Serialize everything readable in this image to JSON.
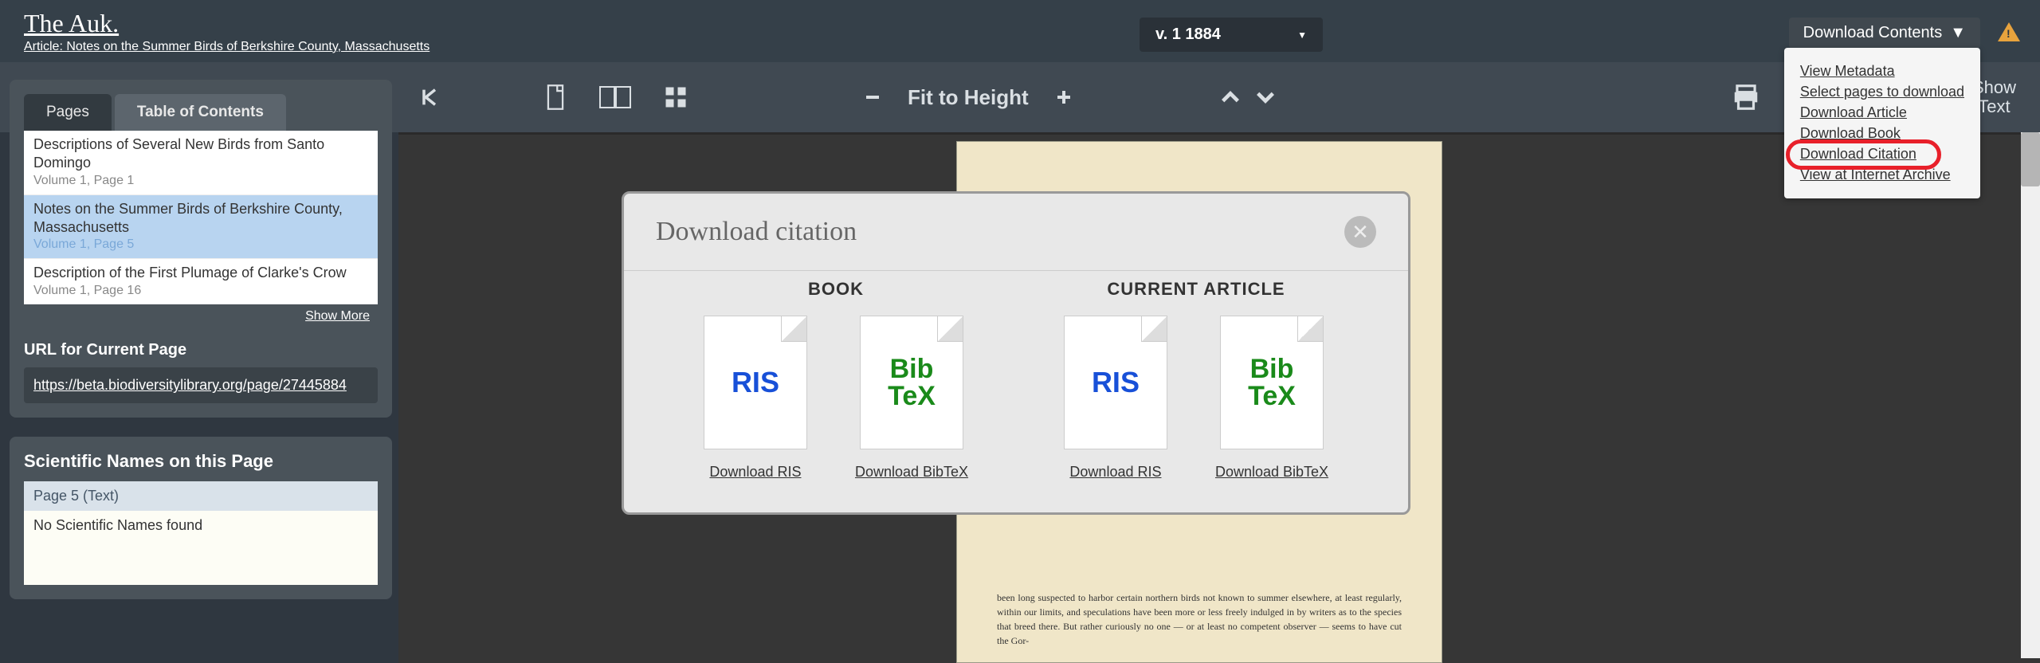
{
  "header": {
    "title": "The Auk.",
    "subtitle": "Article: Notes on the Summer Birds of Berkshire County, Massachusetts",
    "volume": "v. 1 1884",
    "download_contents": "Download Contents"
  },
  "dropdown": {
    "items": [
      "View Metadata",
      "Select pages to download",
      "Download Article",
      "Download Book",
      "Download Citation",
      "View at Internet Archive"
    ]
  },
  "toolbar": {
    "fit": "Fit to Height",
    "show_text": "Show Text"
  },
  "sidebar": {
    "tabs": {
      "pages": "Pages",
      "toc": "Table of Contents"
    },
    "toc": [
      {
        "title": "Descriptions of Several New Birds from Santo Domingo",
        "vol": "Volume 1, Page 1",
        "selected": false
      },
      {
        "title": "Notes on the Summer Birds of Berkshire County, Massachusetts",
        "vol": "Volume 1, Page 5",
        "selected": true
      },
      {
        "title": "Description of the First Plumage of Clarke's Crow",
        "vol": "Volume 1, Page 16",
        "selected": false
      }
    ],
    "show_more": "Show More",
    "url_label": "URL for Current Page",
    "url": "https://beta.biodiversitylibrary.org/page/27445884",
    "sci_label": "Scientific Names on this Page",
    "sci_page": "Page 5 (Text)",
    "sci_none": "No Scientific Names found"
  },
  "modal": {
    "title": "Download citation",
    "book": "BOOK",
    "article": "CURRENT ARTICLE",
    "ris": "RIS",
    "bibtex_l1": "Bib",
    "bibtex_l2": "TeX",
    "download_ris": "Download RIS",
    "download_bibtex": "Download BibTeX"
  },
  "page_text": "been long suspected to harbor certain northern birds not known to summer elsewhere, at least regularly, within our limits, and speculations have been more or less freely indulged in by writers as to the species that breed there. But rather curiously no one — or at least no competent observer — seems to have cut the Gor-"
}
